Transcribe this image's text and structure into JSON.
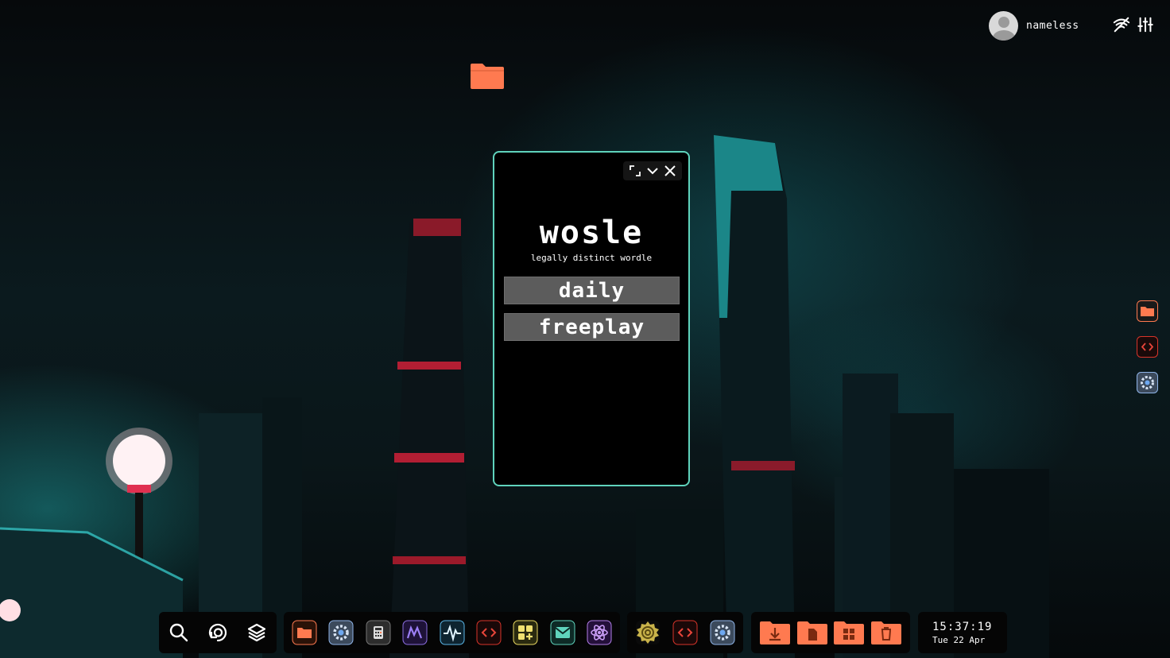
{
  "user": {
    "name": "nameless"
  },
  "system_tray": {
    "icons": [
      "no-wifi-icon",
      "sliders-icon"
    ]
  },
  "desktop": {
    "icons": [
      "folder-icon"
    ]
  },
  "side_launcher": {
    "items": [
      "folder-icon",
      "code-editor-icon",
      "settings-icon"
    ]
  },
  "window": {
    "title": "wosle",
    "subtitle": "legally distinct wordle",
    "buttons": [
      "daily",
      "freeplay"
    ],
    "controls": [
      "maximize-icon",
      "minimize-icon",
      "close-icon"
    ],
    "accent": "#5fd3bc"
  },
  "taskbar": {
    "quick_actions": [
      "search-icon",
      "refresh-icon",
      "layers-icon"
    ],
    "apps": [
      "files",
      "settings",
      "calculator",
      "monitor",
      "activity",
      "code-editor",
      "widgets",
      "mail",
      "atom"
    ],
    "pinned": [
      "weather",
      "code-editor",
      "settings"
    ],
    "folders": [
      "downloads",
      "documents",
      "apps",
      "trash"
    ],
    "clock": {
      "time": "15:37:19",
      "date": "Tue 22 Apr"
    }
  },
  "colors": {
    "folder": "#ff7a50",
    "window_border": "#5fd3bc",
    "button_bg": "#5c5c5c",
    "background": "#0b1a1e"
  }
}
